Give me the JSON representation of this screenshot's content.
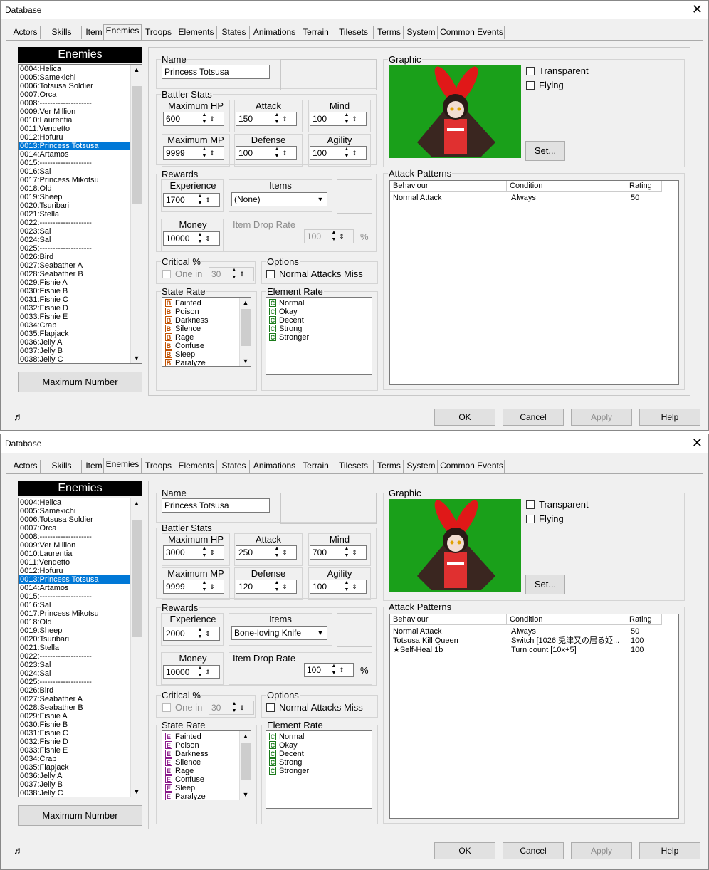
{
  "windows": [
    {
      "title": "Database",
      "tabs": [
        "Actors",
        "Skills",
        "Items",
        "Enemies",
        "Troops",
        "Elements",
        "States",
        "Animations",
        "Terrain",
        "Tilesets",
        "Terms",
        "System",
        "Common Events"
      ],
      "selected_tab": "Enemies",
      "list_header": "Enemies",
      "enemies": [
        "0004:Helica",
        "0005:Samekichi",
        "0006:Totsusa Soldier",
        "0007:Orca",
        "0008:--------------------",
        "0009:Ver Million",
        "0010:Laurentia",
        "0011:Vendetto",
        "0012:Hofuru",
        "0013:Princess Totsusa",
        "0014:Artamos",
        "0015:--------------------",
        "0016:Sal",
        "0017:Princess Mikotsu",
        "0018:Old",
        "0019:Sheep",
        "0020:Tsuribari",
        "0021:Stella",
        "0022:--------------------",
        "0023:Sal",
        "0024:Sal",
        "0025:--------------------",
        "0026:Bird",
        "0027:Seabather  A",
        "0028:Seabather  B",
        "0029:Fishie  A",
        "0030:Fishie  B",
        "0031:Fishie  C",
        "0032:Fishie  D",
        "0033:Fishie  E",
        "0034:Crab",
        "0035:Flapjack",
        "0036:Jelly  A",
        "0037:Jelly  B",
        "0038:Jelly  C"
      ],
      "selected_enemy": "0013:Princess Totsusa",
      "max_number_btn": "Maximum Number",
      "name_label": "Name",
      "name": "Princess Totsusa",
      "battler_stats_label": "Battler Stats",
      "stats": [
        {
          "label": "Maximum HP",
          "value": "600"
        },
        {
          "label": "Attack",
          "value": "150"
        },
        {
          "label": "Mind",
          "value": "100"
        },
        {
          "label": "Maximum MP",
          "value": "9999"
        },
        {
          "label": "Defense",
          "value": "100"
        },
        {
          "label": "Agility",
          "value": "100"
        }
      ],
      "rewards_label": "Rewards",
      "experience_label": "Experience",
      "experience": "1700",
      "items_label": "Items",
      "item": "(None)",
      "money_label": "Money",
      "money": "10000",
      "drop_rate_label": "Item Drop Rate",
      "drop_rate": "100",
      "percent": "%",
      "critical_label": "Critical %",
      "one_in": "One in",
      "critical_value": "30",
      "options_label": "Options",
      "normal_attacks_miss": "Normal Attacks Miss",
      "state_rate_label": "State Rate",
      "state_rank": "B",
      "states": [
        "Fainted",
        "Poison",
        "Darkness",
        "Silence",
        "Rage",
        "Confuse",
        "Sleep",
        "Paralyze"
      ],
      "element_rate_label": "Element Rate",
      "element_rank": "C",
      "elements": [
        "Normal",
        "Okay",
        "Decent",
        "Strong",
        "Stronger"
      ],
      "graphic_label": "Graphic",
      "transparent": "Transparent",
      "flying": "Flying",
      "set_btn": "Set...",
      "attack_patterns_label": "Attack Patterns",
      "ap_headers": [
        "Behaviour",
        "Condition",
        "Rating"
      ],
      "patterns": [
        {
          "behaviour": "Normal Attack",
          "condition": "Always",
          "rating": "50"
        }
      ],
      "buttons": {
        "ok": "OK",
        "cancel": "Cancel",
        "apply": "Apply",
        "help": "Help"
      },
      "music_icon": "♬"
    },
    {
      "title": "Database",
      "tabs": [
        "Actors",
        "Skills",
        "Items",
        "Enemies",
        "Troops",
        "Elements",
        "States",
        "Animations",
        "Terrain",
        "Tilesets",
        "Terms",
        "System",
        "Common Events"
      ],
      "selected_tab": "Enemies",
      "list_header": "Enemies",
      "enemies": [
        "0004:Helica",
        "0005:Samekichi",
        "0006:Totsusa Soldier",
        "0007:Orca",
        "0008:--------------------",
        "0009:Ver Million",
        "0010:Laurentia",
        "0011:Vendetto",
        "0012:Hofuru",
        "0013:Princess Totsusa",
        "0014:Artamos",
        "0015:--------------------",
        "0016:Sal",
        "0017:Princess Mikotsu",
        "0018:Old",
        "0019:Sheep",
        "0020:Tsuribari",
        "0021:Stella",
        "0022:--------------------",
        "0023:Sal",
        "0024:Sal",
        "0025:--------------------",
        "0026:Bird",
        "0027:Seabather  A",
        "0028:Seabather  B",
        "0029:Fishie  A",
        "0030:Fishie  B",
        "0031:Fishie  C",
        "0032:Fishie  D",
        "0033:Fishie  E",
        "0034:Crab",
        "0035:Flapjack",
        "0036:Jelly  A",
        "0037:Jelly  B",
        "0038:Jelly  C"
      ],
      "selected_enemy": "0013:Princess Totsusa",
      "max_number_btn": "Maximum Number",
      "name_label": "Name",
      "name": "Princess Totsusa",
      "battler_stats_label": "Battler Stats",
      "stats": [
        {
          "label": "Maximum HP",
          "value": "3000"
        },
        {
          "label": "Attack",
          "value": "250"
        },
        {
          "label": "Mind",
          "value": "700"
        },
        {
          "label": "Maximum MP",
          "value": "9999"
        },
        {
          "label": "Defense",
          "value": "120"
        },
        {
          "label": "Agility",
          "value": "100"
        }
      ],
      "rewards_label": "Rewards",
      "experience_label": "Experience",
      "experience": "2000",
      "items_label": "Items",
      "item": "Bone-loving Knife",
      "money_label": "Money",
      "money": "10000",
      "drop_rate_label": "Item Drop Rate",
      "drop_rate": "100",
      "percent": "%",
      "critical_label": "Critical %",
      "one_in": "One in",
      "critical_value": "30",
      "options_label": "Options",
      "normal_attacks_miss": "Normal Attacks Miss",
      "state_rate_label": "State Rate",
      "state_rank": "E",
      "states": [
        "Fainted",
        "Poison",
        "Darkness",
        "Silence",
        "Rage",
        "Confuse",
        "Sleep",
        "Paralyze"
      ],
      "element_rate_label": "Element Rate",
      "element_rank": "C",
      "elements": [
        "Normal",
        "Okay",
        "Decent",
        "Strong",
        "Stronger"
      ],
      "graphic_label": "Graphic",
      "transparent": "Transparent",
      "flying": "Flying",
      "set_btn": "Set...",
      "attack_patterns_label": "Attack Patterns",
      "ap_headers": [
        "Behaviour",
        "Condition",
        "Rating"
      ],
      "patterns": [
        {
          "behaviour": "Normal Attack",
          "condition": "Always",
          "rating": "50"
        },
        {
          "behaviour": "Totsusa Kill Queen",
          "condition": "Switch [1026:兎津又の居る姫...",
          "rating": "100"
        },
        {
          "behaviour": "★Self-Heal 1b",
          "condition": "Turn count [10x+5]",
          "rating": "100"
        }
      ],
      "buttons": {
        "ok": "OK",
        "cancel": "Cancel",
        "apply": "Apply",
        "help": "Help"
      },
      "music_icon": "♬"
    }
  ],
  "colors": {
    "selection": "#0078d7",
    "graphic_bg": "#1aa01a",
    "state_rank_B": "#c05000",
    "state_rank_E": "#8a1a8a",
    "element_rank_C": "#1a7a1a"
  }
}
